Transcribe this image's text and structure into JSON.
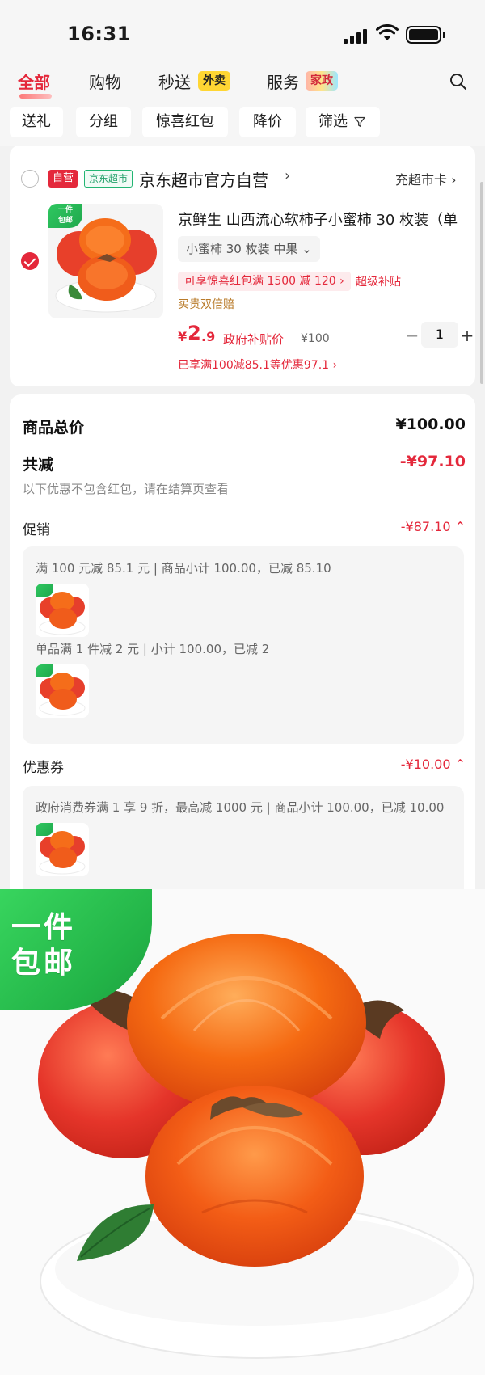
{
  "status_bar": {
    "time": "16:31"
  },
  "tabs": [
    {
      "label": "全部",
      "active": true
    },
    {
      "label": "购物"
    },
    {
      "label": "秒送",
      "badge": "外卖"
    },
    {
      "label": "服务",
      "badge": "家政"
    }
  ],
  "filters": [
    "送礼",
    "分组",
    "惊喜红包",
    "降价",
    "筛选"
  ],
  "shop": {
    "tag_self": "自营",
    "tag_market": "京东超市",
    "name": "京东超市官方自营",
    "arrow": "›",
    "recharge_link": "充超市卡 ›"
  },
  "product": {
    "badge_line1": "一件",
    "badge_line2": "包邮",
    "title": "京鲜生 山西流心软柿子小蜜柿 30 枚装（单",
    "spec": "小蜜柿 30 枚装 中果 ⌄",
    "coupon": "可享惊喜红包满 1500 减 120 ›",
    "super_subsidy": "超级补贴",
    "double_pay": "买贵双倍赔",
    "price_symbol": "¥",
    "price_int": "2",
    "price_dec": ".9",
    "gov_price_label": "政府补贴价",
    "original_price": "¥100",
    "enjoyed_discount": "已享满100减85.1等优惠97.1 ›",
    "quantity": "1",
    "minus": "−",
    "plus": "+"
  },
  "summary": {
    "total_label": "商品总价",
    "total_value": "¥100.00",
    "reduce_label": "共减",
    "reduce_value": "-¥97.10",
    "hint": "以下优惠不包含红包，请在结算页查看",
    "promo_label": "促销",
    "promo_value": "-¥87.10 ⌃",
    "promo_line1": "满 100 元减 85.1 元 | 商品小计 100.00，已减 85.10",
    "promo_line2": "单品满 1 件减 2 元 | 小计 100.00，已减 2",
    "coupon_label": "优惠券",
    "coupon_value": "-¥10.00 ⌃",
    "coupon_line1": "政府消费券满 1 享 9 折，最高减 1000 元 | 商品小计 100.00，已减 10.00"
  },
  "colors": {
    "accent": "#e4283b",
    "green_badge": "#22b347",
    "persimmon": "#f06a1c"
  }
}
